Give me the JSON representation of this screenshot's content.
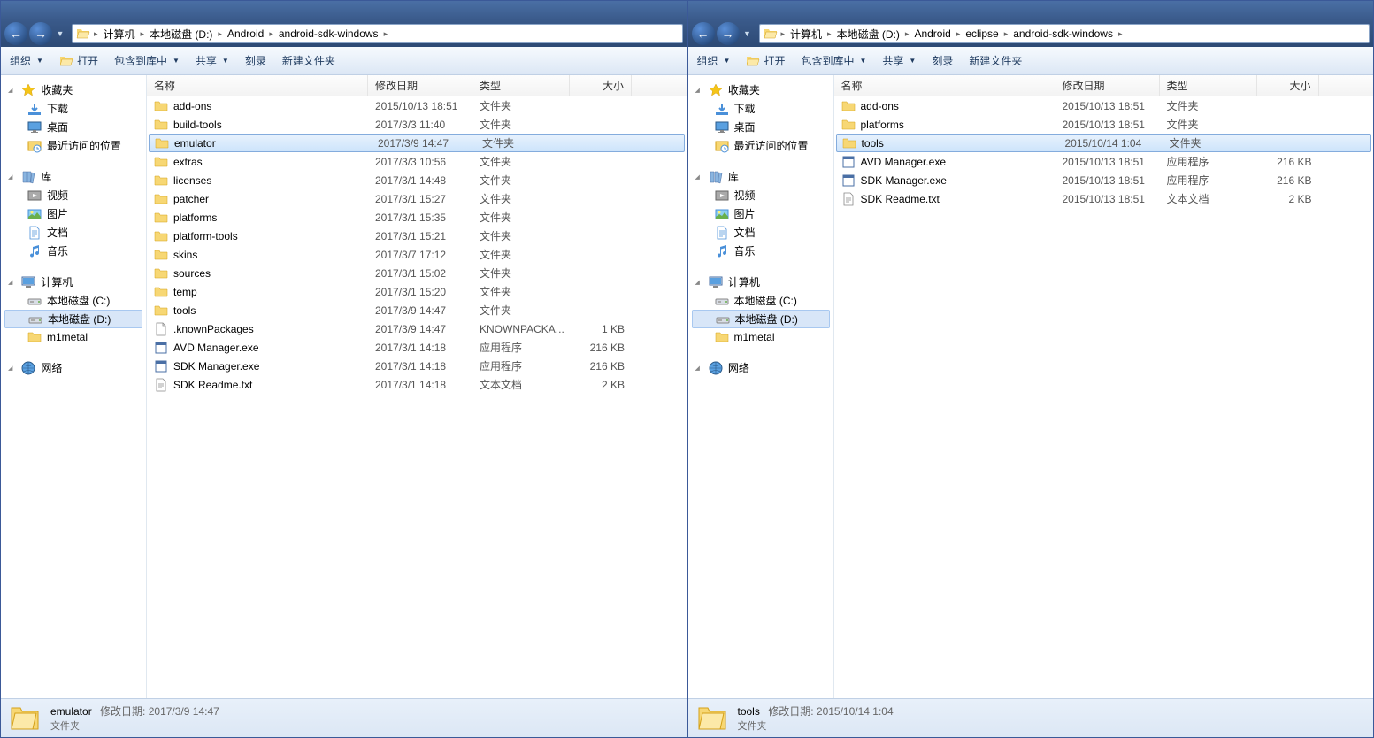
{
  "left": {
    "breadcrumbs": [
      "计算机",
      "本地磁盘 (D:)",
      "Android",
      "android-sdk-windows"
    ],
    "toolbar": {
      "organize": "组织",
      "open": "打开",
      "include": "包含到库中",
      "share": "共享",
      "burn": "刻录",
      "newfolder": "新建文件夹"
    },
    "sidebar": {
      "favorites": {
        "label": "收藏夹",
        "items": [
          {
            "label": "下载",
            "icon": "download"
          },
          {
            "label": "桌面",
            "icon": "desktop"
          },
          {
            "label": "最近访问的位置",
            "icon": "recent"
          }
        ]
      },
      "libraries": {
        "label": "库",
        "items": [
          {
            "label": "视频",
            "icon": "video"
          },
          {
            "label": "图片",
            "icon": "picture"
          },
          {
            "label": "文档",
            "icon": "document"
          },
          {
            "label": "音乐",
            "icon": "music"
          }
        ]
      },
      "computer": {
        "label": "计算机",
        "items": [
          {
            "label": "本地磁盘 (C:)",
            "icon": "drive"
          },
          {
            "label": "本地磁盘 (D:)",
            "icon": "drive",
            "selected": true
          },
          {
            "label": "m1metal",
            "icon": "folder"
          }
        ]
      },
      "network": {
        "label": "网络"
      }
    },
    "columns": {
      "name": "名称",
      "date": "修改日期",
      "type": "类型",
      "size": "大小"
    },
    "rows": [
      {
        "name": "add-ons",
        "date": "2015/10/13 18:51",
        "type": "文件夹",
        "size": "",
        "icon": "folder"
      },
      {
        "name": "build-tools",
        "date": "2017/3/3 11:40",
        "type": "文件夹",
        "size": "",
        "icon": "folder"
      },
      {
        "name": "emulator",
        "date": "2017/3/9 14:47",
        "type": "文件夹",
        "size": "",
        "icon": "folder",
        "selected": true
      },
      {
        "name": "extras",
        "date": "2017/3/3 10:56",
        "type": "文件夹",
        "size": "",
        "icon": "folder"
      },
      {
        "name": "licenses",
        "date": "2017/3/1 14:48",
        "type": "文件夹",
        "size": "",
        "icon": "folder"
      },
      {
        "name": "patcher",
        "date": "2017/3/1 15:27",
        "type": "文件夹",
        "size": "",
        "icon": "folder"
      },
      {
        "name": "platforms",
        "date": "2017/3/1 15:35",
        "type": "文件夹",
        "size": "",
        "icon": "folder"
      },
      {
        "name": "platform-tools",
        "date": "2017/3/1 15:21",
        "type": "文件夹",
        "size": "",
        "icon": "folder"
      },
      {
        "name": "skins",
        "date": "2017/3/7 17:12",
        "type": "文件夹",
        "size": "",
        "icon": "folder"
      },
      {
        "name": "sources",
        "date": "2017/3/1 15:02",
        "type": "文件夹",
        "size": "",
        "icon": "folder"
      },
      {
        "name": "temp",
        "date": "2017/3/1 15:20",
        "type": "文件夹",
        "size": "",
        "icon": "folder"
      },
      {
        "name": "tools",
        "date": "2017/3/9 14:47",
        "type": "文件夹",
        "size": "",
        "icon": "folder"
      },
      {
        "name": ".knownPackages",
        "date": "2017/3/9 14:47",
        "type": "KNOWNPACKA...",
        "size": "1 KB",
        "icon": "file"
      },
      {
        "name": "AVD Manager.exe",
        "date": "2017/3/1 14:18",
        "type": "应用程序",
        "size": "216 KB",
        "icon": "exe"
      },
      {
        "name": "SDK Manager.exe",
        "date": "2017/3/1 14:18",
        "type": "应用程序",
        "size": "216 KB",
        "icon": "exe"
      },
      {
        "name": "SDK Readme.txt",
        "date": "2017/3/1 14:18",
        "type": "文本文档",
        "size": "2 KB",
        "icon": "txt"
      }
    ],
    "status": {
      "name": "emulator",
      "date_label": "修改日期:",
      "date": "2017/3/9 14:47",
      "type": "文件夹"
    }
  },
  "right": {
    "breadcrumbs": [
      "计算机",
      "本地磁盘 (D:)",
      "Android",
      "eclipse",
      "android-sdk-windows"
    ],
    "toolbar": {
      "organize": "组织",
      "open": "打开",
      "include": "包含到库中",
      "share": "共享",
      "burn": "刻录",
      "newfolder": "新建文件夹"
    },
    "sidebar": {
      "favorites": {
        "label": "收藏夹",
        "items": [
          {
            "label": "下载",
            "icon": "download"
          },
          {
            "label": "桌面",
            "icon": "desktop"
          },
          {
            "label": "最近访问的位置",
            "icon": "recent"
          }
        ]
      },
      "libraries": {
        "label": "库",
        "items": [
          {
            "label": "视频",
            "icon": "video"
          },
          {
            "label": "图片",
            "icon": "picture"
          },
          {
            "label": "文档",
            "icon": "document"
          },
          {
            "label": "音乐",
            "icon": "music"
          }
        ]
      },
      "computer": {
        "label": "计算机",
        "items": [
          {
            "label": "本地磁盘 (C:)",
            "icon": "drive"
          },
          {
            "label": "本地磁盘 (D:)",
            "icon": "drive",
            "selected": true
          },
          {
            "label": "m1metal",
            "icon": "folder"
          }
        ]
      },
      "network": {
        "label": "网络"
      }
    },
    "columns": {
      "name": "名称",
      "date": "修改日期",
      "type": "类型",
      "size": "大小"
    },
    "rows": [
      {
        "name": "add-ons",
        "date": "2015/10/13 18:51",
        "type": "文件夹",
        "size": "",
        "icon": "folder"
      },
      {
        "name": "platforms",
        "date": "2015/10/13 18:51",
        "type": "文件夹",
        "size": "",
        "icon": "folder"
      },
      {
        "name": "tools",
        "date": "2015/10/14 1:04",
        "type": "文件夹",
        "size": "",
        "icon": "folder",
        "selected": true
      },
      {
        "name": "AVD Manager.exe",
        "date": "2015/10/13 18:51",
        "type": "应用程序",
        "size": "216 KB",
        "icon": "exe"
      },
      {
        "name": "SDK Manager.exe",
        "date": "2015/10/13 18:51",
        "type": "应用程序",
        "size": "216 KB",
        "icon": "exe"
      },
      {
        "name": "SDK Readme.txt",
        "date": "2015/10/13 18:51",
        "type": "文本文档",
        "size": "2 KB",
        "icon": "txt"
      }
    ],
    "status": {
      "name": "tools",
      "date_label": "修改日期:",
      "date": "2015/10/14 1:04",
      "type": "文件夹"
    }
  }
}
